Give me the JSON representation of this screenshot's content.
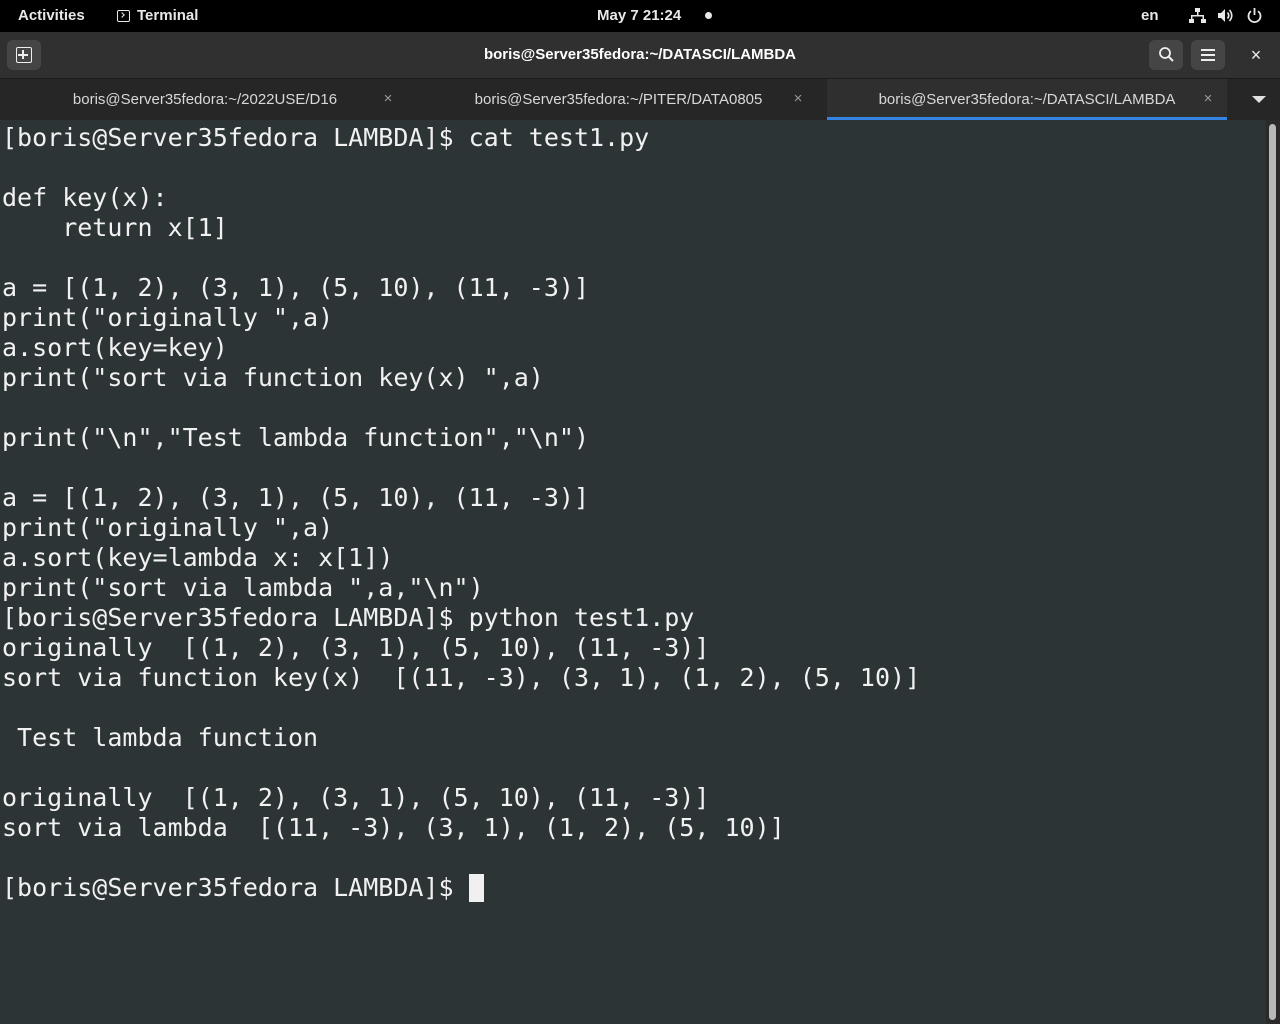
{
  "topbar": {
    "activities": "Activities",
    "app_name": "Terminal",
    "clock": "May 7  21:24",
    "language": "en",
    "icons": [
      "network-icon",
      "volume-icon",
      "power-icon"
    ]
  },
  "window": {
    "title": "boris@Server35fedora:~/DATASCI/LAMBDA",
    "close_glyph": "×"
  },
  "tabs": [
    {
      "label": "boris@Server35fedora:~/2022USE/D16",
      "active": false
    },
    {
      "label": "boris@Server35fedora:~/PITER/DATA0805",
      "active": false
    },
    {
      "label": "boris@Server35fedora:~/DATASCI/LAMBDA",
      "active": true
    }
  ],
  "tab_close_glyph": "×",
  "terminal": {
    "lines": [
      "[boris@Server35fedora LAMBDA]$ cat test1.py",
      "",
      "def key(x):",
      "    return x[1]",
      "",
      "a = [(1, 2), (3, 1), (5, 10), (11, -3)]",
      "print(\"originally \",a)",
      "a.sort(key=key)",
      "print(\"sort via function key(x) \",a)",
      "",
      "print(\"\\n\",\"Test lambda function\",\"\\n\")",
      "",
      "a = [(1, 2), (3, 1), (5, 10), (11, -3)]",
      "print(\"originally \",a)",
      "a.sort(key=lambda x: x[1])",
      "print(\"sort via lambda \",a,\"\\n\")",
      "[boris@Server35fedora LAMBDA]$ python test1.py",
      "originally  [(1, 2), (3, 1), (5, 10), (11, -3)]",
      "sort via function key(x)  [(11, -3), (3, 1), (1, 2), (5, 10)]",
      "",
      " Test lambda function",
      "",
      "originally  [(1, 2), (3, 1), (5, 10), (11, -3)]",
      "sort via lambda  [(11, -3), (3, 1), (1, 2), (5, 10)]",
      ""
    ],
    "prompt": "[boris@Server35fedora LAMBDA]$ "
  },
  "colors": {
    "terminal_bg": "#2d3436",
    "terminal_fg": "#f1f1f1",
    "accent": "#3584e4"
  }
}
